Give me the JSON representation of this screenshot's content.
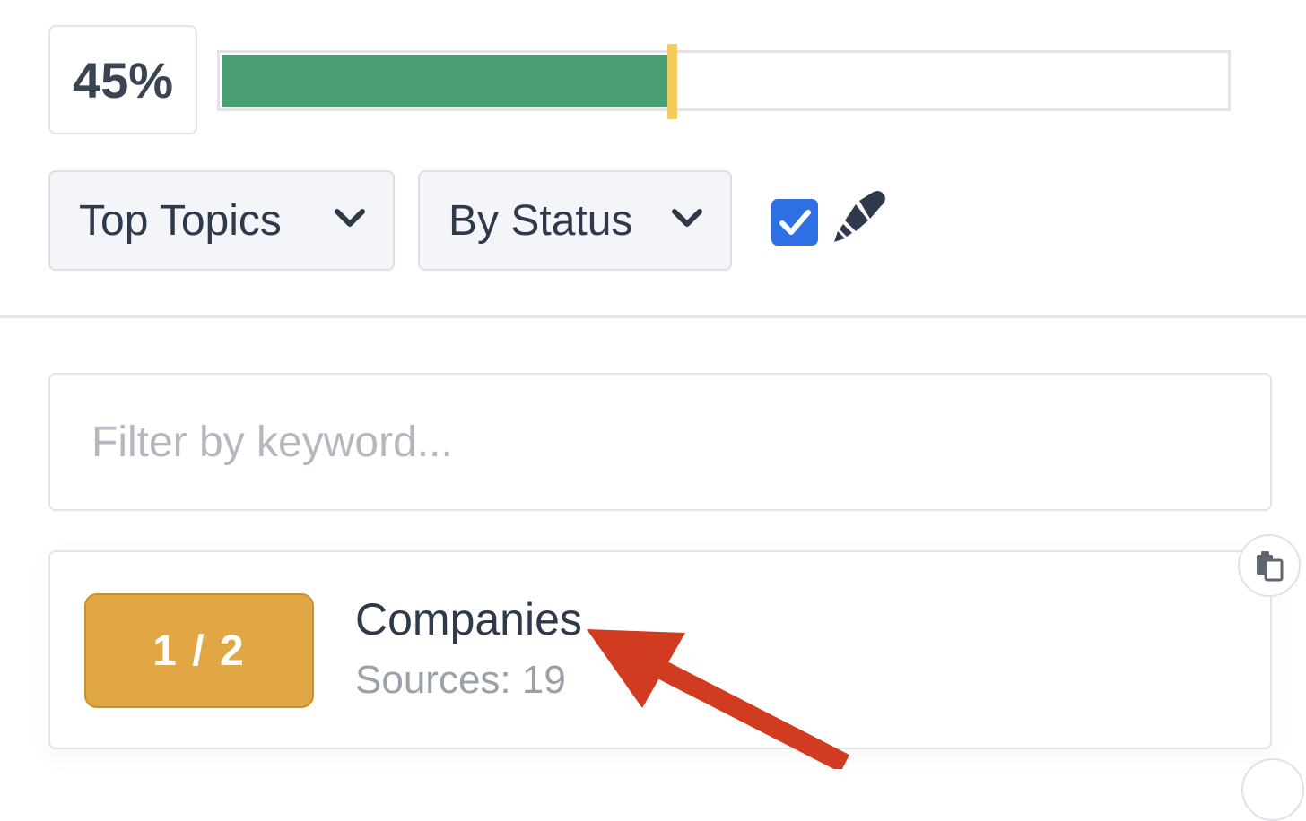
{
  "progress": {
    "percent_label": "45%",
    "value": 0.45
  },
  "filters": {
    "topics_select": {
      "selected": "Top Topics",
      "icon": "chevron-down-icon"
    },
    "status_select": {
      "selected": "By Status",
      "icon": "chevron-down-icon"
    },
    "highlight_checkbox": {
      "checked": true
    },
    "highlighter_icon": "marker-icon"
  },
  "search": {
    "placeholder": "Filter by keyword...",
    "value": ""
  },
  "topics": [
    {
      "badge": "1 / 2",
      "name": "Companies",
      "sources": "Sources: 19",
      "copy_icon": "copy-icon"
    }
  ],
  "annotation": {
    "icon": "red-arrow-icon"
  },
  "colors": {
    "progress_fill": "#4a9f72",
    "progress_marker": "#f2cd5c",
    "badge": "#e0a744",
    "checkbox": "#2f6fe4",
    "annotation_arrow": "#d13b20"
  }
}
